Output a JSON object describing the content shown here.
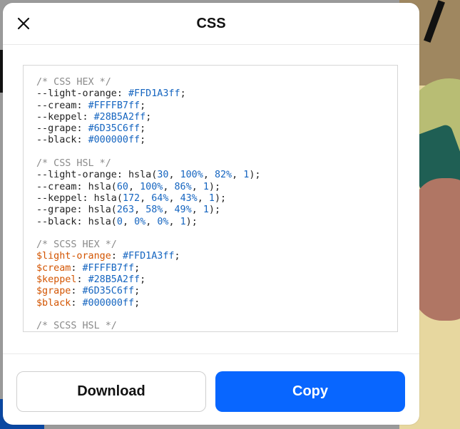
{
  "modal": {
    "title": "CSS",
    "close_icon": "close-icon"
  },
  "code": {
    "blocks": [
      {
        "comment": "/* CSS HEX */",
        "lines": [
          {
            "name": "--light-orange",
            "value": "#FFD1A3ff"
          },
          {
            "name": "--cream",
            "value": "#FFFFB7ff"
          },
          {
            "name": "--keppel",
            "value": "#28B5A2ff"
          },
          {
            "name": "--grape",
            "value": "#6D35C6ff"
          },
          {
            "name": "--black",
            "value": "#000000ff"
          }
        ]
      },
      {
        "comment": "/* CSS HSL */",
        "lines": [
          {
            "name": "--light-orange",
            "h": "30",
            "s": "100%",
            "l": "82%",
            "a": "1"
          },
          {
            "name": "--cream",
            "h": "60",
            "s": "100%",
            "l": "86%",
            "a": "1"
          },
          {
            "name": "--keppel",
            "h": "172",
            "s": "64%",
            "l": "43%",
            "a": "1"
          },
          {
            "name": "--grape",
            "h": "263",
            "s": "58%",
            "l": "49%",
            "a": "1"
          },
          {
            "name": "--black",
            "h": "0",
            "s": "0%",
            "l": "0%",
            "a": "1"
          }
        ]
      },
      {
        "comment": "/* SCSS HEX */",
        "lines": [
          {
            "name": "$light-orange",
            "value": "#FFD1A3ff"
          },
          {
            "name": "$cream",
            "value": "#FFFFB7ff"
          },
          {
            "name": "$keppel",
            "value": "#28B5A2ff"
          },
          {
            "name": "$grape",
            "value": "#6D35C6ff"
          },
          {
            "name": "$black",
            "value": "#000000ff"
          }
        ]
      },
      {
        "comment": "/* SCSS HSL */",
        "lines": []
      }
    ]
  },
  "footer": {
    "download_label": "Download",
    "copy_label": "Copy"
  },
  "colors": {
    "accent": "#0866ff",
    "comment": "#8a8a8a",
    "number": "#1565c0",
    "scss_var": "#d35400"
  }
}
